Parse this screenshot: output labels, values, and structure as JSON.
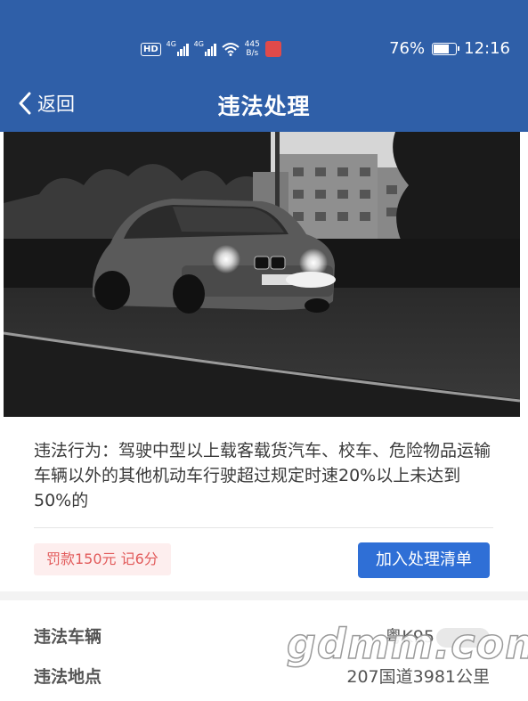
{
  "status_bar": {
    "hd": "HD",
    "net1": "4G",
    "net2": "4G",
    "speed_value": "445",
    "speed_unit": "B/s",
    "battery": "76%",
    "battery_level": 0.76,
    "time": "12:16",
    "bar_color": "#2f5fa8"
  },
  "nav": {
    "back_label": "返回",
    "title": "违法处理"
  },
  "violation": {
    "description": "违法行为：驾驶中型以上载客载货汽车、校车、危险物品运输车辆以外的其他机动车行驶超过规定时速20%以上未达到50%的",
    "penalty": "罚款150元 记6分",
    "add_button": "加入处理清单"
  },
  "details": {
    "vehicle_label": "违法车辆",
    "vehicle_value": "粤K95",
    "location_label": "违法地点",
    "location_value": "207国道3981公里"
  },
  "watermark": "gdmm.com"
}
